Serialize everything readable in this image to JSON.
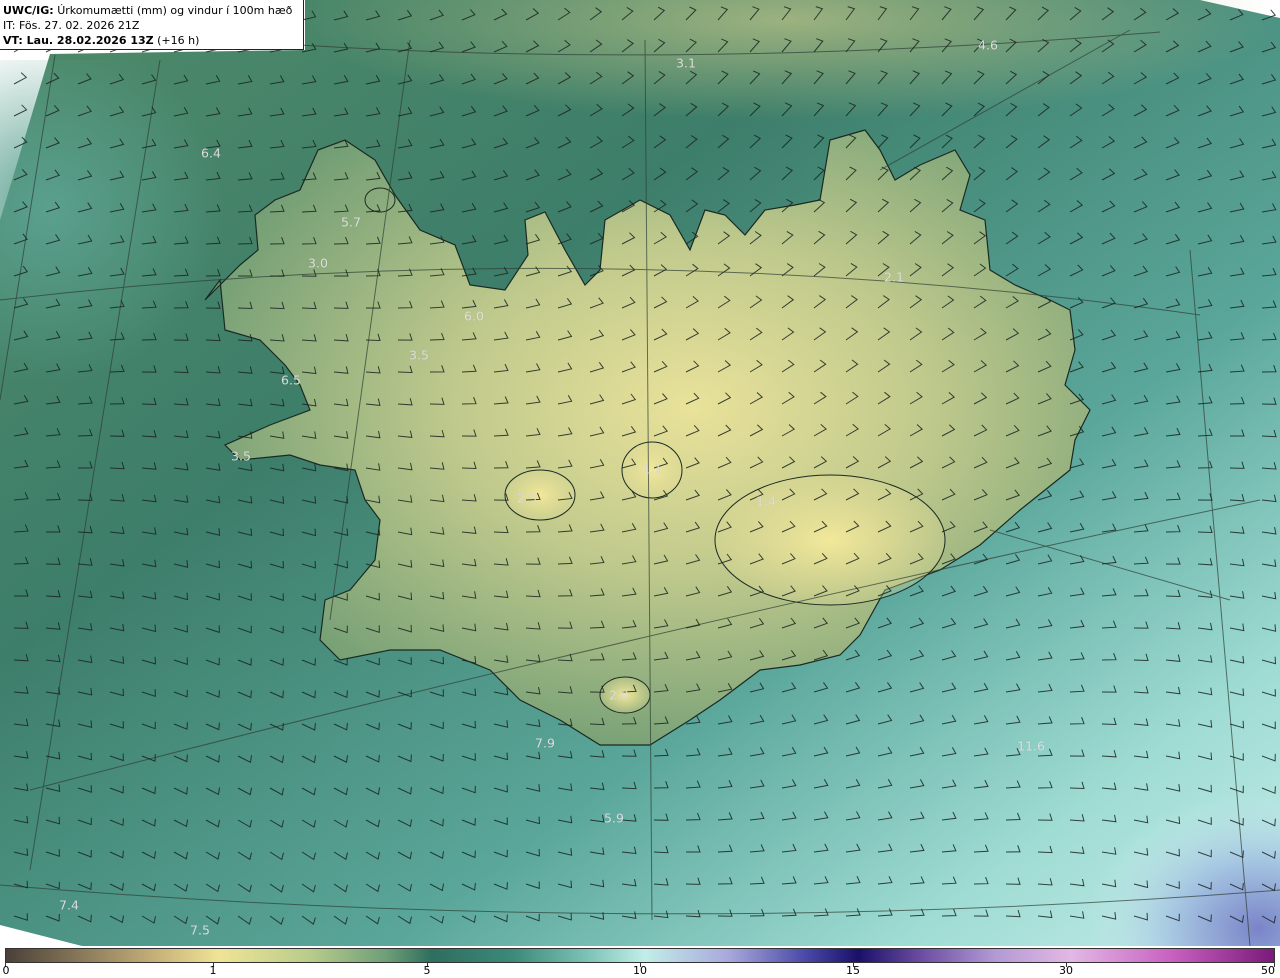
{
  "header": {
    "product": "UWC/IG:",
    "title": "Úrkomumætti (mm) og vindur í 100m hæð",
    "issue_time": "IT: Fös. 27. 02. 2026 21Z",
    "valid_label": "VT: Lau. 28.02.2026 13Z",
    "valid_offset": "(+16 h)"
  },
  "map_labels": [
    {
      "text": "4.6"
    },
    {
      "text": "3.1"
    },
    {
      "text": "6.4"
    },
    {
      "text": "5.7"
    },
    {
      "text": "3.0"
    },
    {
      "text": "6.0"
    },
    {
      "text": "3.5"
    },
    {
      "text": "6.5"
    },
    {
      "text": "3.5"
    },
    {
      "text": "2.1"
    },
    {
      "text": "1.1"
    },
    {
      "text": "2.5"
    },
    {
      "text": "1.4"
    },
    {
      "text": "2.9"
    },
    {
      "text": "7.9"
    },
    {
      "text": "5.9"
    },
    {
      "text": "11.6"
    },
    {
      "text": "7.4"
    },
    {
      "text": "7.5"
    }
  ],
  "colorbar": {
    "ticks": [
      "0",
      "1",
      "5",
      "10",
      "15",
      "30",
      "50"
    ],
    "colors": {
      "dry": "#4a4038",
      "light": "#efe496",
      "moderate": "#2e6e5e",
      "heavy": "#c2eee8",
      "very_heavy": "#1a1068",
      "extreme": "#7a1a7a"
    }
  },
  "colors": {
    "coastline": "#1a2a22",
    "wind_barb": "#1a2420",
    "grid": "#3a4a40"
  }
}
